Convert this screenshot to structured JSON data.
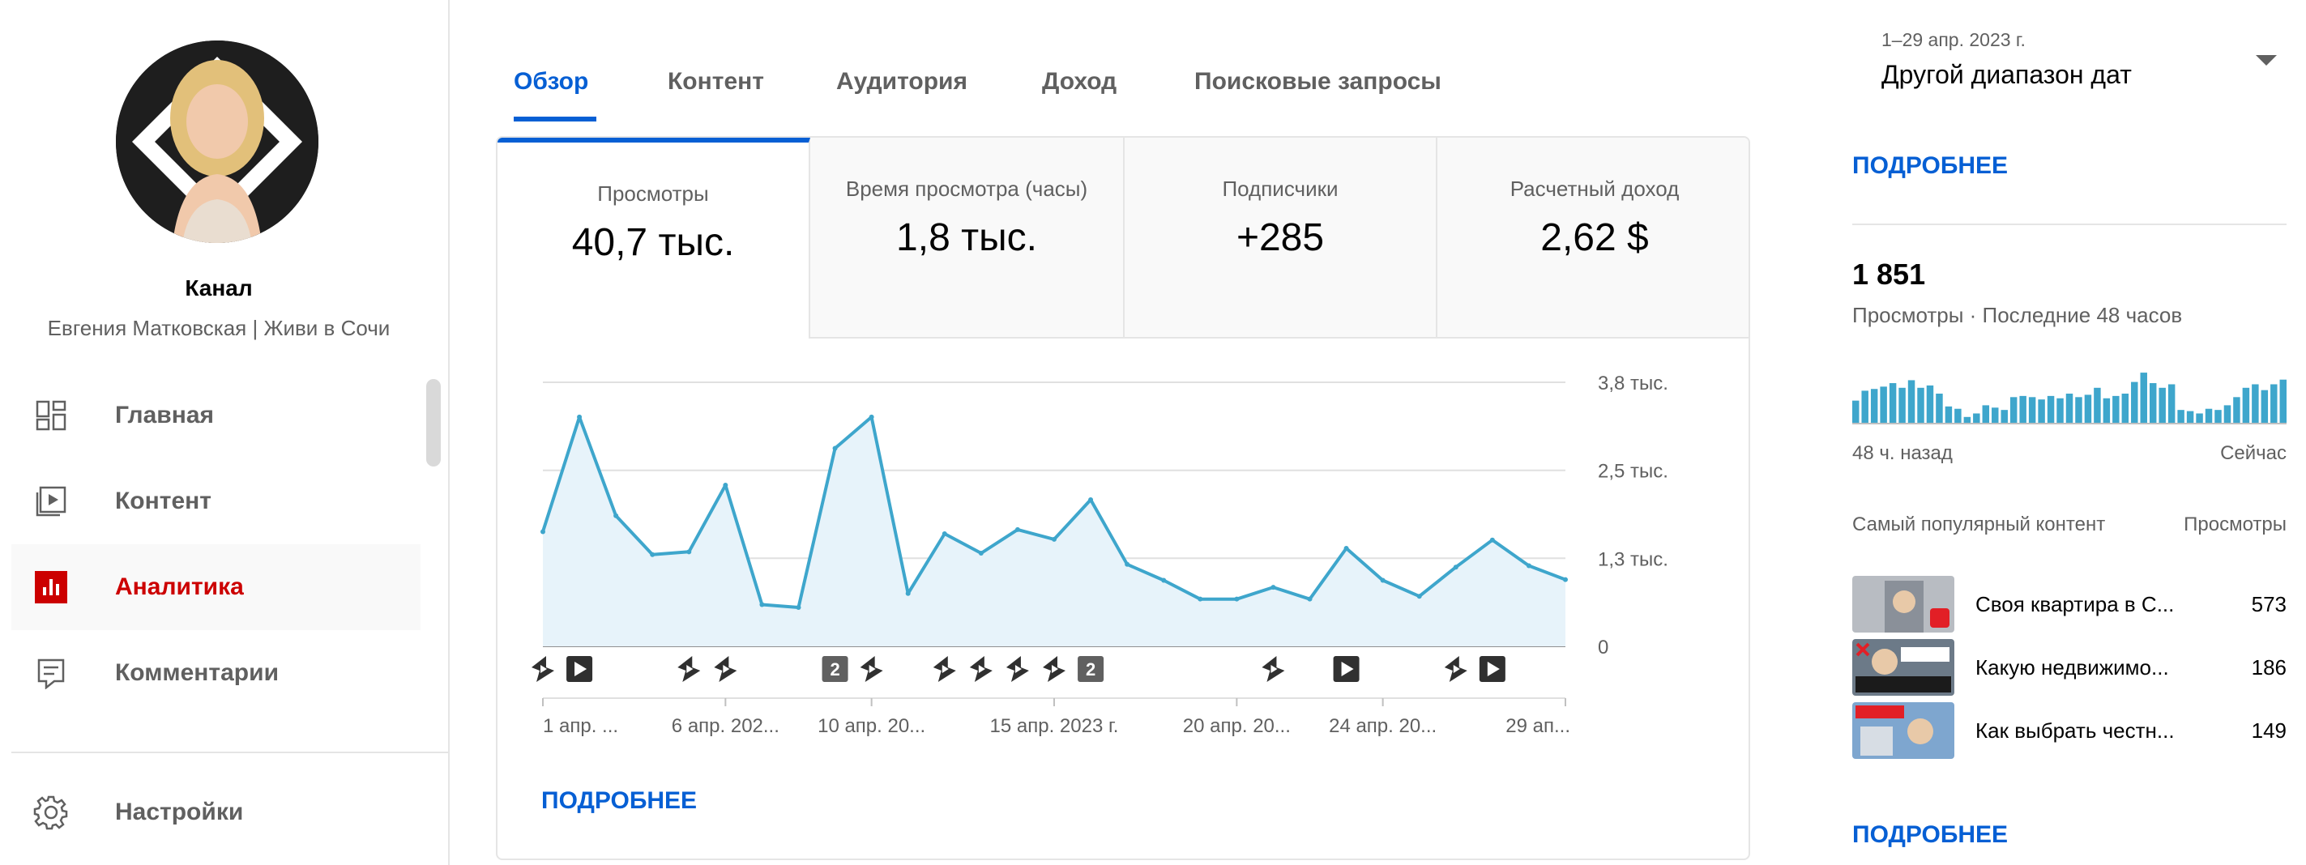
{
  "sidebar": {
    "channel_title": "Канал",
    "channel_name": "Евгения Матковская | Живи в Сочи",
    "items": [
      {
        "label": "Главная",
        "icon": "dashboard-icon"
      },
      {
        "label": "Контент",
        "icon": "content-icon"
      },
      {
        "label": "Аналитика",
        "icon": "analytics-icon",
        "active": true
      },
      {
        "label": "Комментарии",
        "icon": "comments-icon"
      }
    ],
    "settings_label": "Настройки"
  },
  "tabs": [
    {
      "label": "Обзор",
      "active": true
    },
    {
      "label": "Контент"
    },
    {
      "label": "Аудитория"
    },
    {
      "label": "Доход"
    },
    {
      "label": "Поисковые запросы"
    }
  ],
  "date_range": {
    "period": "1–29 апр. 2023 г.",
    "label": "Другой диапазон дат"
  },
  "metrics": [
    {
      "label": "Просмотры",
      "value": "40,7 тыс."
    },
    {
      "label": "Время просмотра (часы)",
      "value": "1,8 тыс."
    },
    {
      "label": "Подписчики",
      "value": "+285"
    },
    {
      "label": "Расчетный доход",
      "value": "2,62 $"
    }
  ],
  "chart_data": {
    "type": "area",
    "y_tick_labels": [
      "0",
      "1,3 тыс.",
      "2,5 тыс.",
      "3,8 тыс."
    ],
    "y_ticks": [
      0,
      1267,
      2533,
      3800
    ],
    "ylim": [
      0,
      4200
    ],
    "x_tick_labels": [
      "1 апр. ...",
      "6 апр. 202...",
      "10 апр. 20...",
      "15 апр. 2023 г.",
      "20 апр. 20...",
      "24 апр. 20...",
      "29 ап..."
    ],
    "x_tick_days": [
      1,
      6,
      10,
      15,
      20,
      24,
      29
    ],
    "x": [
      1,
      2,
      3,
      4,
      5,
      6,
      7,
      8,
      9,
      10,
      11,
      12,
      13,
      14,
      15,
      16,
      17,
      18,
      19,
      20,
      21,
      22,
      23,
      24,
      25,
      26,
      27,
      28,
      29
    ],
    "values": [
      1650,
      3300,
      1880,
      1320,
      1360,
      2320,
      600,
      560,
      2850,
      3300,
      760,
      1620,
      1340,
      1680,
      1540,
      2110,
      1180,
      950,
      680,
      680,
      850,
      680,
      1410,
      950,
      720,
      1140,
      1530,
      1160,
      960
    ],
    "grid": true,
    "color": "#3ea6cc",
    "markers": [
      {
        "day": 1,
        "type": "short-icon"
      },
      {
        "day": 2,
        "type": "play-icon"
      },
      {
        "day": 5,
        "type": "short-icon"
      },
      {
        "day": 6,
        "type": "short-icon"
      },
      {
        "day": 9,
        "type": "badge",
        "label": "2"
      },
      {
        "day": 10,
        "type": "short-icon"
      },
      {
        "day": 12,
        "type": "short-icon"
      },
      {
        "day": 13,
        "type": "short-icon"
      },
      {
        "day": 14,
        "type": "short-icon"
      },
      {
        "day": 15,
        "type": "short-icon"
      },
      {
        "day": 16,
        "type": "badge",
        "label": "2"
      },
      {
        "day": 21,
        "type": "short-icon"
      },
      {
        "day": 23,
        "type": "play-icon"
      },
      {
        "day": 26,
        "type": "short-icon"
      },
      {
        "day": 27,
        "type": "play-icon"
      }
    ]
  },
  "main_more": "ПОДРОБНЕЕ",
  "realtime": {
    "more_top": "ПОДРОБНЕЕ",
    "count": "1 851",
    "subtitle": "Просмотры · Последние 48 часов",
    "left_label": "48 ч. назад",
    "right_label": "Сейчас",
    "bars": [
      0.38,
      0.55,
      0.58,
      0.62,
      0.68,
      0.6,
      0.73,
      0.6,
      0.64,
      0.5,
      0.28,
      0.24,
      0.1,
      0.16,
      0.3,
      0.26,
      0.22,
      0.44,
      0.46,
      0.44,
      0.4,
      0.46,
      0.42,
      0.5,
      0.44,
      0.48,
      0.6,
      0.42,
      0.46,
      0.5,
      0.7,
      0.86,
      0.68,
      0.6,
      0.66,
      0.22,
      0.2,
      0.16,
      0.24,
      0.22,
      0.3,
      0.44,
      0.6,
      0.66,
      0.56,
      0.66,
      0.74
    ],
    "top_header_left": "Самый популярный контент",
    "top_header_right": "Просмотры",
    "top": [
      {
        "title": "Своя квартира в С...",
        "views": "573"
      },
      {
        "title": "Какую недвижимо...",
        "views": "186"
      },
      {
        "title": "Как выбрать честн...",
        "views": "149"
      }
    ],
    "more_bottom": "ПОДРОБНЕЕ"
  }
}
